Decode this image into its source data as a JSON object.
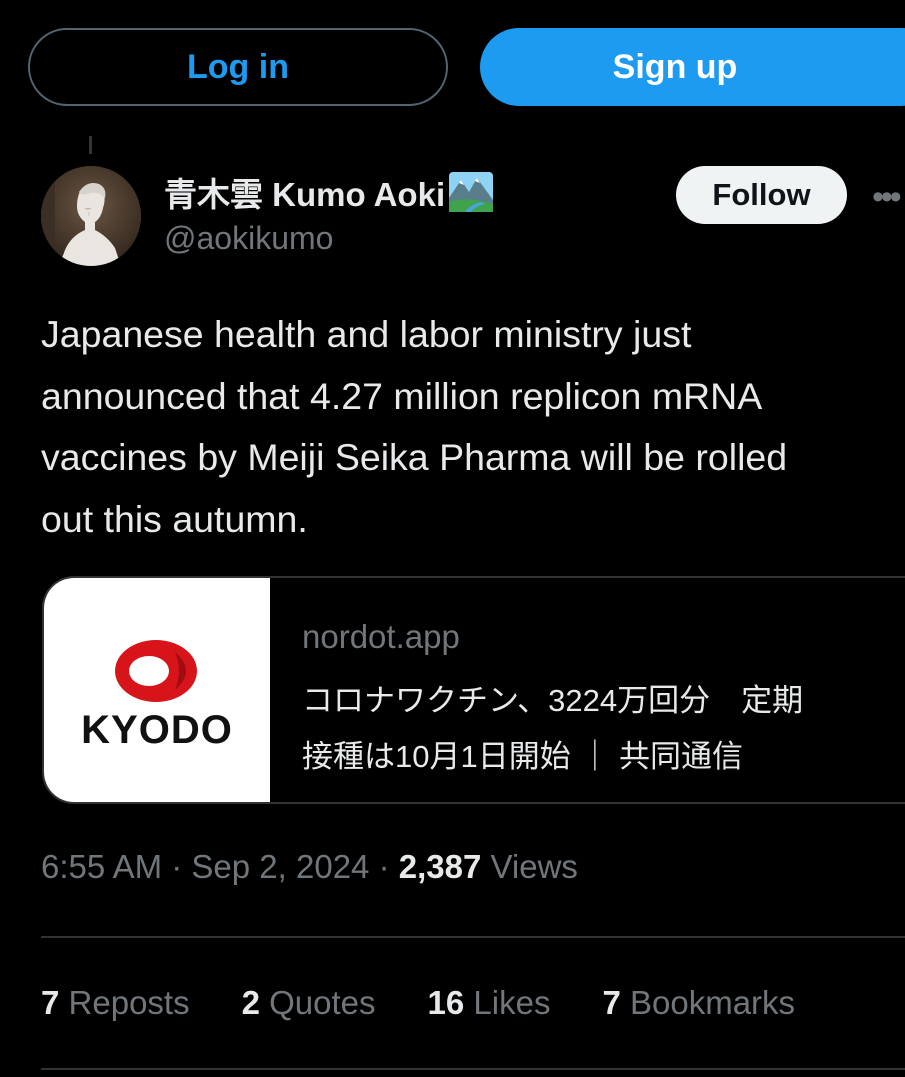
{
  "auth": {
    "login_label": "Log in",
    "signup_label": "Sign up"
  },
  "author": {
    "display_name": "青木雲 Kumo Aoki",
    "name_emoji_icon": "national-park-icon",
    "handle": "@aokikumo",
    "follow_label": "Follow",
    "more_icon": "more-horizontal-icon"
  },
  "tweet": {
    "text": "Japanese health and labor ministry just\nannounced that 4.27 million replicon mRNA\nvaccines by Meiji Seika Pharma will be rolled\nout this autumn."
  },
  "card": {
    "logo_text": "KYODO",
    "domain": "nordot.app",
    "title_line1": "コロナワクチン、3224万回分　定期",
    "title_line2": "接種は10月1日開始 ｜ 共同通信"
  },
  "meta": {
    "time": "6:55 AM",
    "sep1": " · ",
    "date": "Sep 2, 2024",
    "sep2": " · ",
    "views_count": "2,387",
    "views_label": " Views"
  },
  "stats": [
    {
      "count": "7",
      "label": " Reposts"
    },
    {
      "count": "2",
      "label": " Quotes"
    },
    {
      "count": "16",
      "label": " Likes"
    },
    {
      "count": "7",
      "label": " Bookmarks"
    }
  ],
  "colors": {
    "accent": "#1d9bf0",
    "background": "#000000",
    "text_primary": "#e7e9ea",
    "text_secondary": "#71767b",
    "border": "#2f3336",
    "kyodo_red": "#d7141a"
  }
}
